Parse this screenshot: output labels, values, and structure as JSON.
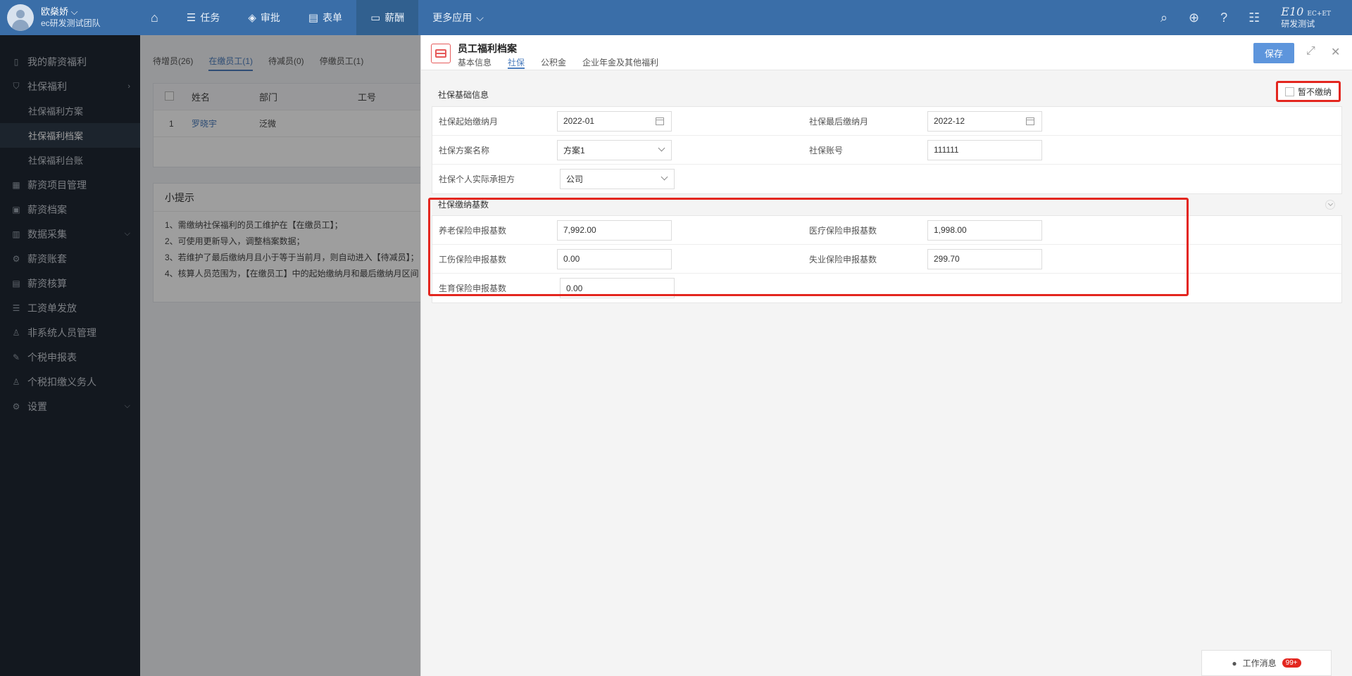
{
  "user": {
    "name": "欧燊娇",
    "team": "ec研发测试团队"
  },
  "nav": {
    "items": [
      {
        "label": "任务",
        "icon": "☰"
      },
      {
        "label": "审批",
        "icon": "◈"
      },
      {
        "label": "表单",
        "icon": "▤"
      },
      {
        "label": "薪酬",
        "icon": "▭"
      },
      {
        "label": "更多应用",
        "icon": ""
      }
    ]
  },
  "brand": {
    "top": "E10",
    "ec": "EC+ET",
    "sub": "研发测试"
  },
  "sidebar": {
    "items": [
      {
        "label": "我的薪资福利"
      },
      {
        "label": "社保福利"
      },
      {
        "label": "社保福利方案"
      },
      {
        "label": "社保福利档案"
      },
      {
        "label": "社保福利台账"
      },
      {
        "label": "薪资项目管理"
      },
      {
        "label": "薪资档案"
      },
      {
        "label": "数据采集"
      },
      {
        "label": "薪资账套"
      },
      {
        "label": "薪资核算"
      },
      {
        "label": "工资单发放"
      },
      {
        "label": "非系统人员管理"
      },
      {
        "label": "个税申报表"
      },
      {
        "label": "个税扣缴义务人"
      },
      {
        "label": "设置"
      }
    ]
  },
  "main": {
    "tabs": [
      "待增员(26)",
      "在缴员工(1)",
      "待减员(0)",
      "停缴员工(1)"
    ],
    "table": {
      "headers": [
        "姓名",
        "部门",
        "工号"
      ],
      "rows": [
        {
          "index": "1",
          "name": "罗晓宇",
          "dept": "泛微"
        }
      ]
    },
    "tips": {
      "title": "小提示",
      "lines": [
        "1、需缴纳社保福利的员工维护在【在缴员工】；",
        "2、可使用更新导入，调整档案数据；",
        "3、若维护了最后缴纳月且小于等于当前月，则自动进入【待减员】；",
        "4、核算人员范围为，【在缴员工】中的起始缴纳月和最后缴纳月区间"
      ]
    }
  },
  "drawer": {
    "title": "员工福利档案",
    "tabs": [
      "基本信息",
      "社保",
      "公积金",
      "企业年金及其他福利"
    ],
    "save": "保存",
    "basic": {
      "title": "社保基础信息",
      "pause_label": "暂不缴纳",
      "start_month_label": "社保起始缴纳月",
      "start_month": "2022-01",
      "end_month_label": "社保最后缴纳月",
      "end_month": "2022-12",
      "scheme_label": "社保方案名称",
      "scheme": "方案1",
      "account_label": "社保账号",
      "account": "111111",
      "bearer_label": "社保个人实际承担方",
      "bearer": "公司"
    },
    "base": {
      "title": "社保缴纳基数",
      "pension_label": "养老保险申报基数",
      "pension": "7,992.00",
      "medical_label": "医疗保险申报基数",
      "medical": "1,998.00",
      "injury_label": "工伤保险申报基数",
      "injury": "0.00",
      "unemployment_label": "失业保险申报基数",
      "unemployment": "299.70",
      "maternity_label": "生育保险申报基数",
      "maternity": "0.00"
    }
  },
  "messages": {
    "label": "工作消息",
    "badge": "99+"
  }
}
